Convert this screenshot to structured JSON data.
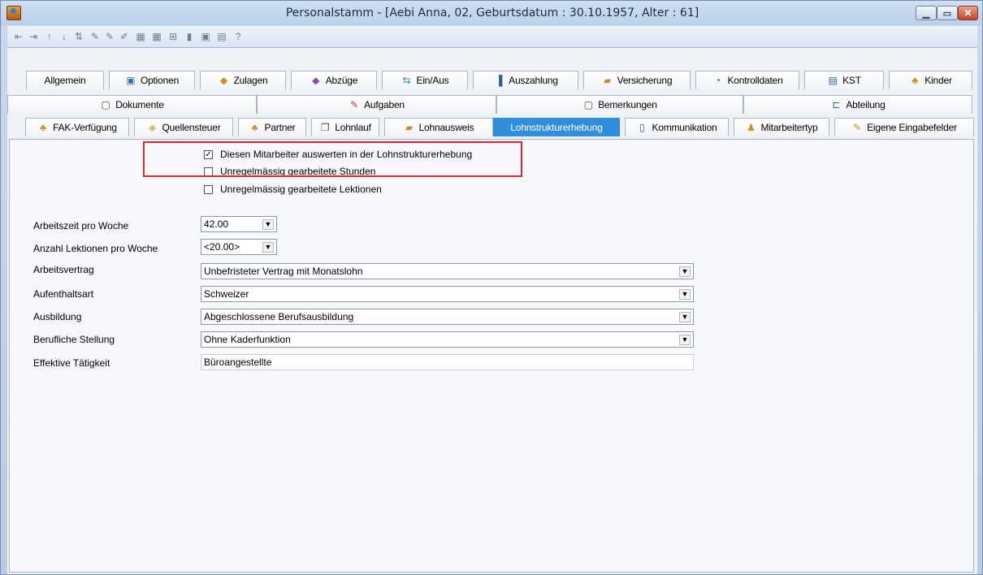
{
  "window": {
    "title": "Personalstamm - [Aebi Anna, 02, Geburtsdatum : 30.10.1957, Alter : 61]"
  },
  "toolbar_icons": [
    "first-record-icon",
    "last-record-icon",
    "prev-record-icon",
    "next-record-icon",
    "sort-icon",
    "spellcheck-icon",
    "spellcheck-all-icon",
    "edit-icon",
    "grid-icon",
    "grid-alt-icon",
    "insert-icon",
    "delete-icon",
    "save-icon",
    "print-icon",
    "help-icon"
  ],
  "tabs_row1": [
    {
      "label": "Allgemein",
      "icon": ""
    },
    {
      "label": "Optionen",
      "icon": "options-icon"
    },
    {
      "label": "Zulagen",
      "icon": "allowance-icon"
    },
    {
      "label": "Abzüge",
      "icon": "deduction-icon"
    },
    {
      "label": "Ein/Aus",
      "icon": "in-out-icon"
    },
    {
      "label": "Auszahlung",
      "icon": "payout-icon"
    },
    {
      "label": "Versicherung",
      "icon": "insurance-icon"
    },
    {
      "label": "Kontrolldaten",
      "icon": "control-icon"
    },
    {
      "label": "KST",
      "icon": "cost-center-icon"
    },
    {
      "label": "Kinder",
      "icon": "children-icon"
    }
  ],
  "tabs_row2": [
    {
      "label": "Dokumente",
      "icon": "document-icon"
    },
    {
      "label": "Aufgaben",
      "icon": "tasks-icon"
    },
    {
      "label": "Bemerkungen",
      "icon": "notes-icon"
    },
    {
      "label": "Abteilung",
      "icon": "department-icon"
    }
  ],
  "tabs_row3": [
    {
      "label": "FAK-Verfügung",
      "icon": "family-icon"
    },
    {
      "label": "Quellensteuer",
      "icon": "tax-icon"
    },
    {
      "label": "Partner",
      "icon": "partner-icon"
    },
    {
      "label": "Lohnlauf",
      "icon": "payroll-icon"
    },
    {
      "label": "Lohnausweis",
      "icon": "certificate-icon"
    },
    {
      "label": "Lohnstrukturerhebung",
      "icon": ""
    },
    {
      "label": "Kommunikation",
      "icon": "phone-icon"
    },
    {
      "label": "Mitarbeitertyp",
      "icon": "employee-type-icon"
    },
    {
      "label": "Eigene Eingabefelder",
      "icon": "custom-fields-icon"
    }
  ],
  "checkboxes": [
    {
      "label": "Diesen Mitarbeiter auswerten in der Lohnstrukturerhebung",
      "checked": true,
      "mark": "✓"
    },
    {
      "label": "Unregelmässig gearbeitete Stunden",
      "checked": false,
      "mark": ""
    },
    {
      "label": "Unregelmässig gearbeitete Lektionen",
      "checked": false,
      "mark": ""
    }
  ],
  "fields": [
    {
      "label": "Arbeitszeit pro Woche",
      "value": "42.00"
    },
    {
      "label": "Anzahl Lektionen pro Woche",
      "value": "<20.00>"
    },
    {
      "label": "Arbeitsvertrag",
      "value": "Unbefristeter Vertrag mit Monatslohn"
    },
    {
      "label": "Aufenthaltsart",
      "value": "Schweizer"
    },
    {
      "label": "Ausbildung",
      "value": "Abgeschlossene Berufsausbildung"
    },
    {
      "label": "Berufliche Stellung",
      "value": "Ohne Kaderfunktion"
    },
    {
      "label": "Effektive Tätigkeit",
      "value": "Büroangestellte"
    }
  ],
  "colors": {
    "active_tab": "#2f8fde",
    "highlight_border": "#e0262b"
  }
}
